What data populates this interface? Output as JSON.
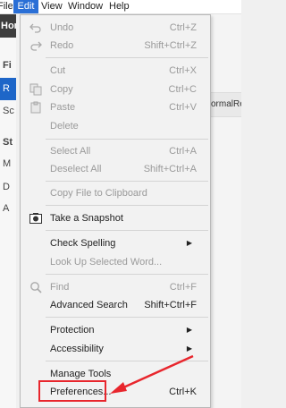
{
  "menubar": {
    "file": "File",
    "edit": "Edit",
    "view": "View",
    "window": "Window",
    "help": "Help"
  },
  "left": {
    "home_tab": "Home",
    "c1": "Fi",
    "c2": "R",
    "c3": "Sc",
    "c4": "St",
    "c5": "M",
    "c6": "D",
    "c7": "A"
  },
  "right": {
    "row_text": "ormalRep"
  },
  "menu": {
    "undo": {
      "label": "Undo",
      "shortcut": "Ctrl+Z"
    },
    "redo": {
      "label": "Redo",
      "shortcut": "Shift+Ctrl+Z"
    },
    "cut": {
      "label": "Cut",
      "shortcut": "Ctrl+X"
    },
    "copy": {
      "label": "Copy",
      "shortcut": "Ctrl+C"
    },
    "paste": {
      "label": "Paste",
      "shortcut": "Ctrl+V"
    },
    "delete": {
      "label": "Delete"
    },
    "select_all": {
      "label": "Select All",
      "shortcut": "Ctrl+A"
    },
    "deselect_all": {
      "label": "Deselect All",
      "shortcut": "Shift+Ctrl+A"
    },
    "copy_clipboard": {
      "label": "Copy File to Clipboard"
    },
    "snapshot": {
      "label": "Take a Snapshot"
    },
    "check_spelling": {
      "label": "Check Spelling"
    },
    "lookup": {
      "label": "Look Up Selected Word..."
    },
    "find": {
      "label": "Find",
      "shortcut": "Ctrl+F"
    },
    "advanced_search": {
      "label": "Advanced Search",
      "shortcut": "Shift+Ctrl+F"
    },
    "protection": {
      "label": "Protection"
    },
    "accessibility": {
      "label": "Accessibility"
    },
    "manage_tools": {
      "label": "Manage Tools"
    },
    "preferences": {
      "label": "Preferences...",
      "shortcut": "Ctrl+K"
    }
  },
  "colors": {
    "menu_highlight": "#2a6fd6",
    "annotation": "#e8262d",
    "disabled_text": "#9a9a9a"
  }
}
